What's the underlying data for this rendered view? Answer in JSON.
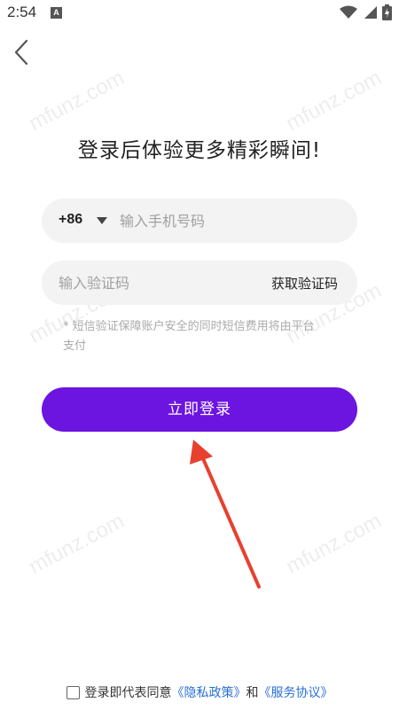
{
  "status_bar": {
    "time": "2:54",
    "notification_icon": "a-icon",
    "notification_letter": "A",
    "icons": [
      "wifi-icon",
      "signal-icon",
      "battery-icon"
    ]
  },
  "back_icon": "chevron-left-icon",
  "watermark": "mfunz.com",
  "headline": "登录后体验更多精彩瞬间!",
  "phone_field": {
    "country_code": "+86",
    "caret_icon": "caret-down-icon",
    "placeholder": "输入手机号码",
    "value": ""
  },
  "code_field": {
    "placeholder": "输入验证码",
    "value": "",
    "get_code_label": "获取验证码"
  },
  "hint": "* 短信验证保障账户安全的同时短信费用将由平台支付",
  "login_button_label": "立即登录",
  "agreement": {
    "checked": false,
    "prefix": "登录即代表同意",
    "privacy_link": "《隐私政策》",
    "conjunction": "和",
    "service_link": "《服务协议》"
  },
  "colors": {
    "accent": "#6c14e0",
    "link": "#2a6fd6",
    "field_bg": "#f3f3f3",
    "annotation_arrow": "#e8402f"
  }
}
